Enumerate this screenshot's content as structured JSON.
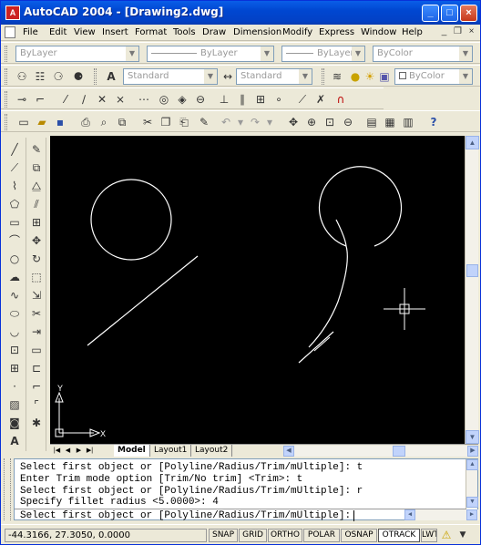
{
  "window": {
    "title": "AutoCAD 2004 - [Drawing2.dwg]",
    "app_icon": "A",
    "colors": {
      "titlebar": "#0a5ee8",
      "canvas": "#000000",
      "geometry": "#ffffff"
    }
  },
  "menubar": {
    "items": [
      "File",
      "Edit",
      "View",
      "Insert",
      "Format",
      "Tools",
      "Draw",
      "Dimension",
      "Modify",
      "Express",
      "Window",
      "Help"
    ]
  },
  "layers_toolbar": {
    "layer": "ByLayer",
    "linetype": "ByLayer",
    "lineweight": "ByLayer",
    "color": "ByColor"
  },
  "styles_toolbar": {
    "text_style": "Standard",
    "dim_style": "Standard"
  },
  "layout_tabs": {
    "tabs": [
      "Model",
      "Layout1",
      "Layout2"
    ],
    "active": "Model"
  },
  "command_history": [
    "Select first object or [Polyline/Radius/Trim/mUltiple]: t",
    "Enter Trim mode option [Trim/No trim] <Trim>: t",
    "Select first object or [Polyline/Radius/Trim/mUltiple]: r",
    "Specify fillet radius <5.0000>: 4"
  ],
  "command_prompt": "Select first object or [Polyline/Radius/Trim/mUltiple]:",
  "status": {
    "coordinates": "-44.3166, 27.3050, 0.0000",
    "toggles": [
      {
        "label": "SNAP",
        "on": false
      },
      {
        "label": "GRID",
        "on": false
      },
      {
        "label": "ORTHO",
        "on": false
      },
      {
        "label": "POLAR",
        "on": false
      },
      {
        "label": "OSNAP",
        "on": false
      },
      {
        "label": "OTRACK",
        "on": true
      },
      {
        "label": "LWT",
        "on": false
      }
    ]
  },
  "ucs": {
    "x_label": "X",
    "y_label": "Y"
  },
  "icons": {
    "draw": [
      "line-icon",
      "construction-line-icon",
      "polyline-icon",
      "polygon-icon",
      "rectangle-icon",
      "arc-icon",
      "circle-icon",
      "revision-cloud-icon",
      "spline-icon",
      "ellipse-icon",
      "ellipse-arc-icon",
      "insert-block-icon",
      "make-block-icon",
      "point-icon",
      "hatch-icon",
      "region-icon",
      "mtext-icon"
    ],
    "modify": [
      "erase-icon",
      "copy-icon",
      "mirror-icon",
      "offset-icon",
      "array-icon",
      "move-icon",
      "rotate-icon",
      "scale-icon",
      "stretch-icon",
      "trim-icon",
      "extend-icon",
      "break-at-point-icon",
      "break-icon",
      "chamfer-icon",
      "fillet-icon",
      "explode-icon"
    ]
  }
}
